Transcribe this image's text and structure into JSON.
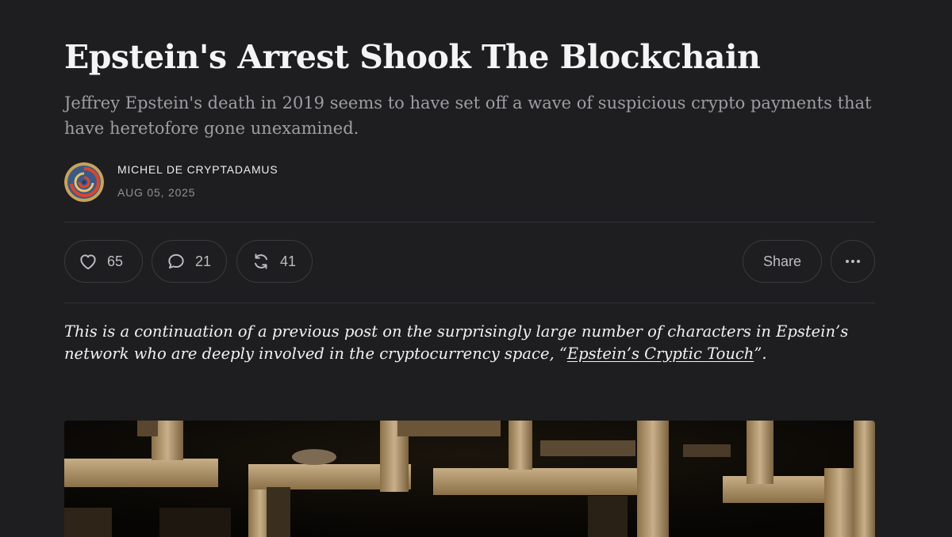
{
  "post": {
    "title": "Epstein's Arrest Shook The Blockchain",
    "subtitle": "Jeffrey Epstein's death in 2019 seems to have set off a wave of suspicious crypto payments that have heretofore gone unexamined.",
    "author": "MICHEL DE CRYPTADAMUS",
    "date": "AUG 05, 2025"
  },
  "actions": {
    "like": {
      "icon": "heart-icon",
      "count": "65"
    },
    "comment": {
      "icon": "comment-icon",
      "count": "21"
    },
    "restack": {
      "icon": "restack-icon",
      "count": "41"
    },
    "share_label": "Share",
    "more_icon": "ellipsis-icon"
  },
  "intro": {
    "text": "This is a continuation of a previous post on the surprisingly large number of characters in Epstein’s network who are deeply involved in the cryptocurrency space, “",
    "link_text": "Epstein’s Cryptic Touch",
    "suffix": "”."
  },
  "colors": {
    "background": "#1e1e20",
    "text": "#f2f2f2",
    "muted": "#9e9ea2",
    "border": "#3a3a3f"
  }
}
